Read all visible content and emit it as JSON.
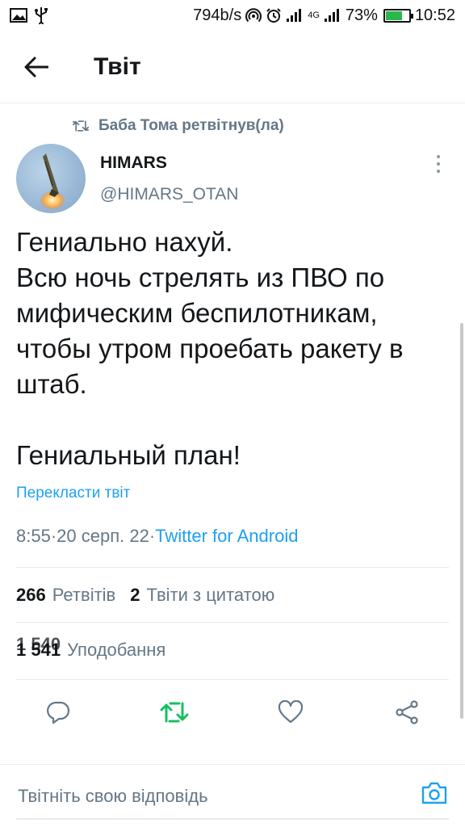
{
  "status_bar": {
    "net_speed": "794b/s",
    "network": "4G",
    "battery_percent": "73%",
    "battery_level": 0.73,
    "time": "10:52"
  },
  "header": {
    "title": "Твіт"
  },
  "tweet": {
    "retweet_context": "Баба Тома ретвітнув(ла)",
    "author_name": "HIMARS",
    "author_handle": "@HIMARS_OTAN",
    "text": "Гениально нахуй.\nВсю ночь стрелять из ПВО по мифическим беспилотникам, чтобы утром проебать ракету в штаб.\n\nГениальный план!",
    "translate_label": "Перекласти твіт",
    "time": "8:55",
    "date": "20 серп. 22",
    "separator": " · ",
    "source": "Twitter for Android"
  },
  "stats": {
    "retweets_count": "266",
    "retweets_label": "Ретвітів",
    "quotes_count": "2",
    "quotes_label": "Твіти з цитатою",
    "likes_count": "1 541",
    "likes_count_previous": "1 540",
    "likes_label": "Уподобання"
  },
  "reply": {
    "placeholder": "Твітніть свою відповідь"
  },
  "colors": {
    "accent": "#1da1f2",
    "retweet_green": "#17bf63",
    "secondary_text": "#657786"
  },
  "icons": {
    "back": "arrow-left-icon",
    "retweet_context": "retweet-icon",
    "more": "more-vertical-icon",
    "reply": "reply-icon",
    "retweet": "retweet-icon",
    "like": "heart-icon",
    "share": "share-icon",
    "camera": "camera-icon"
  }
}
